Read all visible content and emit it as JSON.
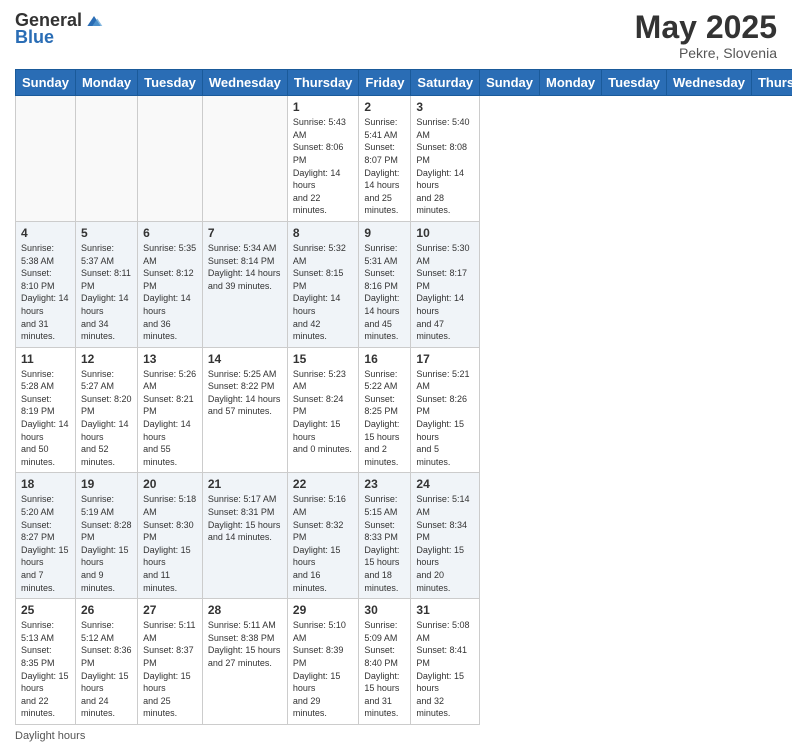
{
  "header": {
    "logo_general": "General",
    "logo_blue": "Blue",
    "title": "May 2025",
    "subtitle": "Pekre, Slovenia"
  },
  "days_of_week": [
    "Sunday",
    "Monday",
    "Tuesday",
    "Wednesday",
    "Thursday",
    "Friday",
    "Saturday"
  ],
  "weeks": [
    [
      {
        "day": "",
        "info": ""
      },
      {
        "day": "",
        "info": ""
      },
      {
        "day": "",
        "info": ""
      },
      {
        "day": "",
        "info": ""
      },
      {
        "day": "1",
        "info": "Sunrise: 5:43 AM\nSunset: 8:06 PM\nDaylight: 14 hours\nand 22 minutes."
      },
      {
        "day": "2",
        "info": "Sunrise: 5:41 AM\nSunset: 8:07 PM\nDaylight: 14 hours\nand 25 minutes."
      },
      {
        "day": "3",
        "info": "Sunrise: 5:40 AM\nSunset: 8:08 PM\nDaylight: 14 hours\nand 28 minutes."
      }
    ],
    [
      {
        "day": "4",
        "info": "Sunrise: 5:38 AM\nSunset: 8:10 PM\nDaylight: 14 hours\nand 31 minutes."
      },
      {
        "day": "5",
        "info": "Sunrise: 5:37 AM\nSunset: 8:11 PM\nDaylight: 14 hours\nand 34 minutes."
      },
      {
        "day": "6",
        "info": "Sunrise: 5:35 AM\nSunset: 8:12 PM\nDaylight: 14 hours\nand 36 minutes."
      },
      {
        "day": "7",
        "info": "Sunrise: 5:34 AM\nSunset: 8:14 PM\nDaylight: 14 hours\nand 39 minutes."
      },
      {
        "day": "8",
        "info": "Sunrise: 5:32 AM\nSunset: 8:15 PM\nDaylight: 14 hours\nand 42 minutes."
      },
      {
        "day": "9",
        "info": "Sunrise: 5:31 AM\nSunset: 8:16 PM\nDaylight: 14 hours\nand 45 minutes."
      },
      {
        "day": "10",
        "info": "Sunrise: 5:30 AM\nSunset: 8:17 PM\nDaylight: 14 hours\nand 47 minutes."
      }
    ],
    [
      {
        "day": "11",
        "info": "Sunrise: 5:28 AM\nSunset: 8:19 PM\nDaylight: 14 hours\nand 50 minutes."
      },
      {
        "day": "12",
        "info": "Sunrise: 5:27 AM\nSunset: 8:20 PM\nDaylight: 14 hours\nand 52 minutes."
      },
      {
        "day": "13",
        "info": "Sunrise: 5:26 AM\nSunset: 8:21 PM\nDaylight: 14 hours\nand 55 minutes."
      },
      {
        "day": "14",
        "info": "Sunrise: 5:25 AM\nSunset: 8:22 PM\nDaylight: 14 hours\nand 57 minutes."
      },
      {
        "day": "15",
        "info": "Sunrise: 5:23 AM\nSunset: 8:24 PM\nDaylight: 15 hours\nand 0 minutes."
      },
      {
        "day": "16",
        "info": "Sunrise: 5:22 AM\nSunset: 8:25 PM\nDaylight: 15 hours\nand 2 minutes."
      },
      {
        "day": "17",
        "info": "Sunrise: 5:21 AM\nSunset: 8:26 PM\nDaylight: 15 hours\nand 5 minutes."
      }
    ],
    [
      {
        "day": "18",
        "info": "Sunrise: 5:20 AM\nSunset: 8:27 PM\nDaylight: 15 hours\nand 7 minutes."
      },
      {
        "day": "19",
        "info": "Sunrise: 5:19 AM\nSunset: 8:28 PM\nDaylight: 15 hours\nand 9 minutes."
      },
      {
        "day": "20",
        "info": "Sunrise: 5:18 AM\nSunset: 8:30 PM\nDaylight: 15 hours\nand 11 minutes."
      },
      {
        "day": "21",
        "info": "Sunrise: 5:17 AM\nSunset: 8:31 PM\nDaylight: 15 hours\nand 14 minutes."
      },
      {
        "day": "22",
        "info": "Sunrise: 5:16 AM\nSunset: 8:32 PM\nDaylight: 15 hours\nand 16 minutes."
      },
      {
        "day": "23",
        "info": "Sunrise: 5:15 AM\nSunset: 8:33 PM\nDaylight: 15 hours\nand 18 minutes."
      },
      {
        "day": "24",
        "info": "Sunrise: 5:14 AM\nSunset: 8:34 PM\nDaylight: 15 hours\nand 20 minutes."
      }
    ],
    [
      {
        "day": "25",
        "info": "Sunrise: 5:13 AM\nSunset: 8:35 PM\nDaylight: 15 hours\nand 22 minutes."
      },
      {
        "day": "26",
        "info": "Sunrise: 5:12 AM\nSunset: 8:36 PM\nDaylight: 15 hours\nand 24 minutes."
      },
      {
        "day": "27",
        "info": "Sunrise: 5:11 AM\nSunset: 8:37 PM\nDaylight: 15 hours\nand 25 minutes."
      },
      {
        "day": "28",
        "info": "Sunrise: 5:11 AM\nSunset: 8:38 PM\nDaylight: 15 hours\nand 27 minutes."
      },
      {
        "day": "29",
        "info": "Sunrise: 5:10 AM\nSunset: 8:39 PM\nDaylight: 15 hours\nand 29 minutes."
      },
      {
        "day": "30",
        "info": "Sunrise: 5:09 AM\nSunset: 8:40 PM\nDaylight: 15 hours\nand 31 minutes."
      },
      {
        "day": "31",
        "info": "Sunrise: 5:08 AM\nSunset: 8:41 PM\nDaylight: 15 hours\nand 32 minutes."
      }
    ]
  ],
  "footer": {
    "daylight_label": "Daylight hours"
  }
}
